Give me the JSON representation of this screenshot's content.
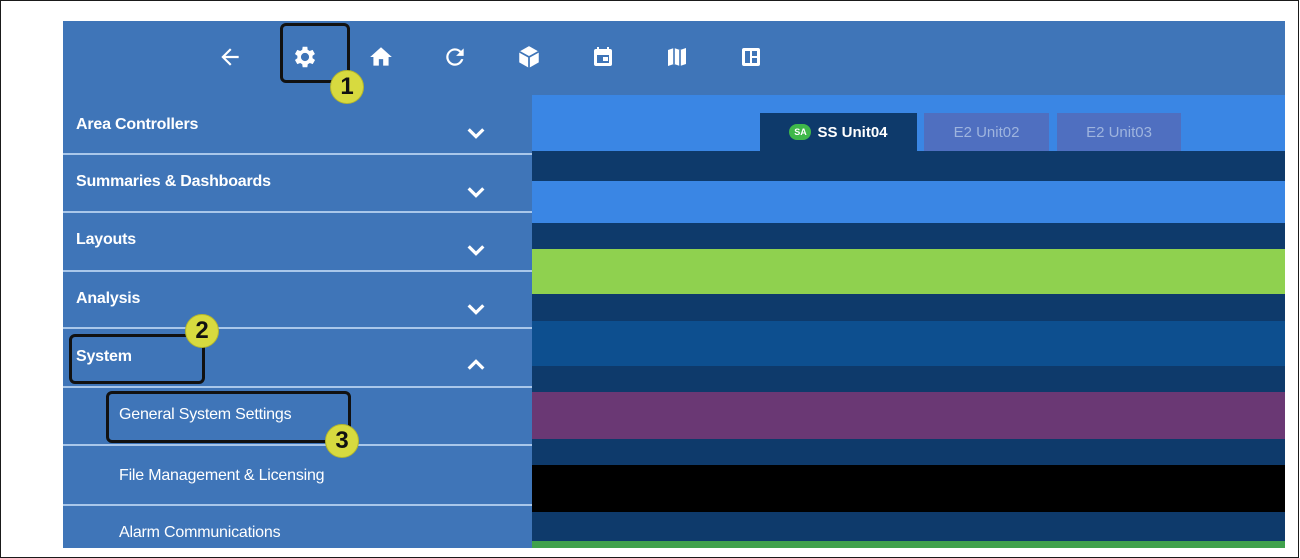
{
  "toolbar": {
    "icons": [
      "back-arrow-icon",
      "gear-icon",
      "home-icon",
      "refresh-icon",
      "cube-icon",
      "calendar-icon",
      "map-icon",
      "layout-icon"
    ],
    "color": "#3f75b8"
  },
  "sidebar": {
    "sections": [
      {
        "label": "Area Controllers",
        "expanded": false
      },
      {
        "label": "Summaries & Dashboards",
        "expanded": false
      },
      {
        "label": "Layouts",
        "expanded": false
      },
      {
        "label": "Analysis",
        "expanded": false
      },
      {
        "label": "System",
        "expanded": true
      }
    ],
    "system_items": [
      {
        "label": "General System Settings"
      },
      {
        "label": "File Management & Licensing"
      },
      {
        "label": "Alarm Communications"
      }
    ]
  },
  "tabs": [
    {
      "badge": "SA",
      "label": "SS Unit04",
      "active": true
    },
    {
      "label": "E2 Unit02",
      "active": false
    },
    {
      "label": "E2 Unit03",
      "active": false
    }
  ],
  "bands": [
    "#3a86e4",
    "#8fd14f",
    "#0d4f8f",
    "#6a3874",
    "#000000",
    "#3fa14c"
  ],
  "annotations": [
    "1",
    "2",
    "3"
  ]
}
